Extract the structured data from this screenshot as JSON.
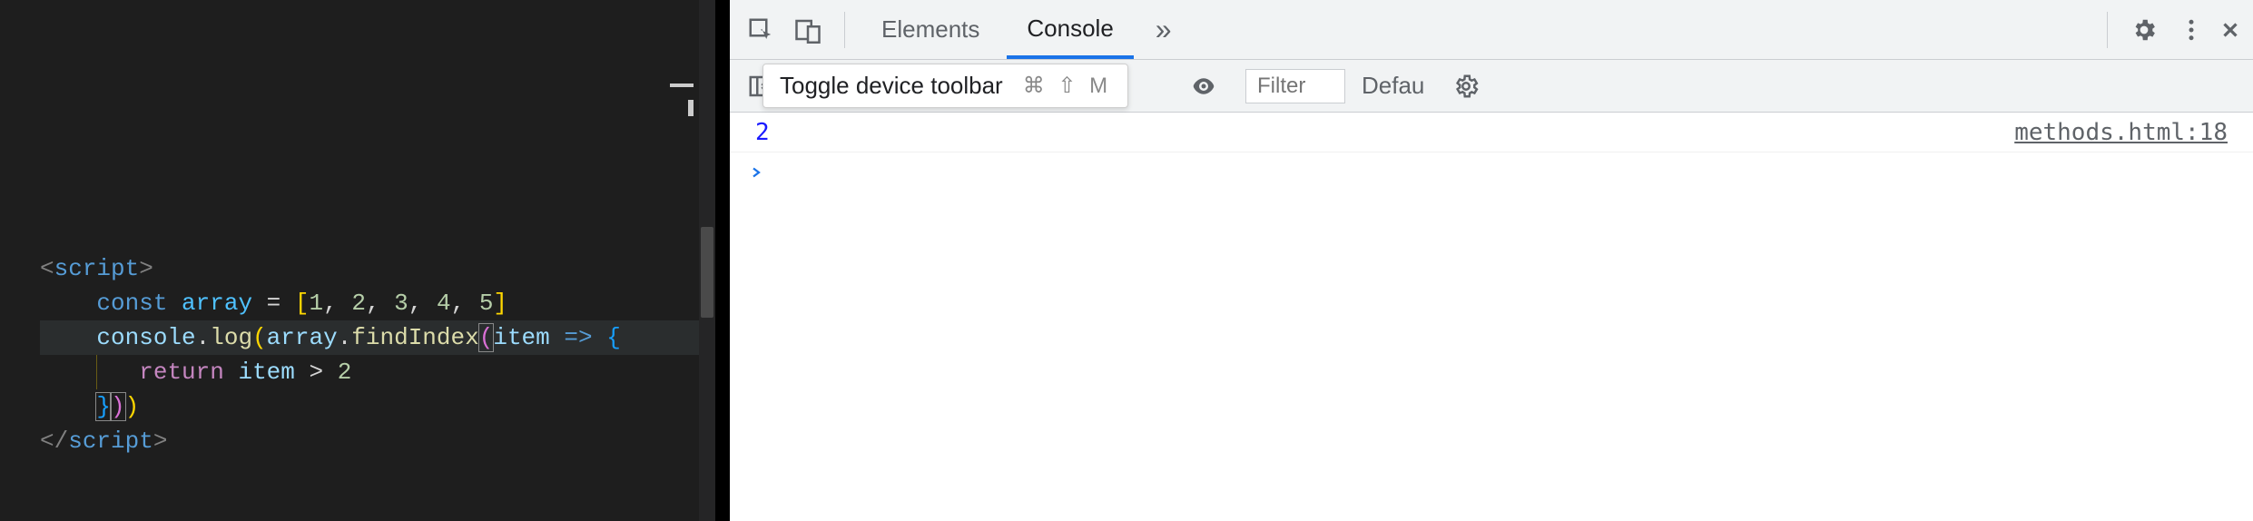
{
  "editor": {
    "lines": [
      {
        "tokens": [
          {
            "t": "<",
            "c": "tok-angle"
          },
          {
            "t": "script",
            "c": "tok-tag"
          },
          {
            "t": ">",
            "c": "tok-angle"
          }
        ]
      },
      {
        "tokens": [
          {
            "t": "    ",
            "c": ""
          },
          {
            "t": "const",
            "c": "tok-kw"
          },
          {
            "t": " ",
            "c": ""
          },
          {
            "t": "array",
            "c": "tok-const"
          },
          {
            "t": " ",
            "c": ""
          },
          {
            "t": "=",
            "c": "tok-op"
          },
          {
            "t": " ",
            "c": ""
          },
          {
            "t": "[",
            "c": "tok-br-y"
          },
          {
            "t": "1",
            "c": "tok-num"
          },
          {
            "t": ", ",
            "c": "tok-pun"
          },
          {
            "t": "2",
            "c": "tok-num"
          },
          {
            "t": ", ",
            "c": "tok-pun"
          },
          {
            "t": "3",
            "c": "tok-num"
          },
          {
            "t": ", ",
            "c": "tok-pun"
          },
          {
            "t": "4",
            "c": "tok-num"
          },
          {
            "t": ", ",
            "c": "tok-pun"
          },
          {
            "t": "5",
            "c": "tok-num"
          },
          {
            "t": "]",
            "c": "tok-br-y"
          }
        ]
      },
      {
        "hl": true,
        "tokens": [
          {
            "t": "    ",
            "c": ""
          },
          {
            "t": "console",
            "c": "tok-var"
          },
          {
            "t": ".",
            "c": "tok-pun"
          },
          {
            "t": "log",
            "c": "tok-fn"
          },
          {
            "t": "(",
            "c": "tok-br-y"
          },
          {
            "t": "array",
            "c": "tok-var"
          },
          {
            "t": ".",
            "c": "tok-pun"
          },
          {
            "t": "findIndex",
            "c": "tok-fn"
          },
          {
            "t": "(",
            "c": "tok-br-p match-br"
          },
          {
            "t": "item",
            "c": "tok-var"
          },
          {
            "t": " ",
            "c": ""
          },
          {
            "t": "=>",
            "c": "tok-arrow"
          },
          {
            "t": " ",
            "c": ""
          },
          {
            "t": "{",
            "c": "tok-br-b"
          }
        ]
      },
      {
        "tokens": [
          {
            "t": "    ",
            "c": ""
          },
          {
            "guide": true
          },
          {
            "t": "   ",
            "c": ""
          },
          {
            "t": "return",
            "c": "tok-ret"
          },
          {
            "t": " ",
            "c": ""
          },
          {
            "t": "item",
            "c": "tok-var"
          },
          {
            "t": " ",
            "c": ""
          },
          {
            "t": ">",
            "c": "tok-op"
          },
          {
            "t": " ",
            "c": ""
          },
          {
            "t": "2",
            "c": "tok-num"
          }
        ]
      },
      {
        "tokens": [
          {
            "t": "    ",
            "c": ""
          },
          {
            "t": "}",
            "c": "tok-br-b match-br"
          },
          {
            "t": ")",
            "c": "tok-br-p match-br"
          },
          {
            "t": ")",
            "c": "tok-br-y"
          }
        ]
      },
      {
        "tokens": [
          {
            "t": "</",
            "c": "tok-angle"
          },
          {
            "t": "script",
            "c": "tok-tag"
          },
          {
            "t": ">",
            "c": "tok-angle"
          }
        ]
      }
    ]
  },
  "devtools": {
    "tabs": {
      "elements": "Elements",
      "console": "Console",
      "more": "»"
    },
    "tooltip": {
      "label": "Toggle device toolbar",
      "shortcut": "⌘ ⇧ M"
    },
    "toolbar": {
      "filter_placeholder": "Filter",
      "level": "Defau"
    },
    "log": {
      "value": "2",
      "source": "methods.html:18"
    }
  }
}
